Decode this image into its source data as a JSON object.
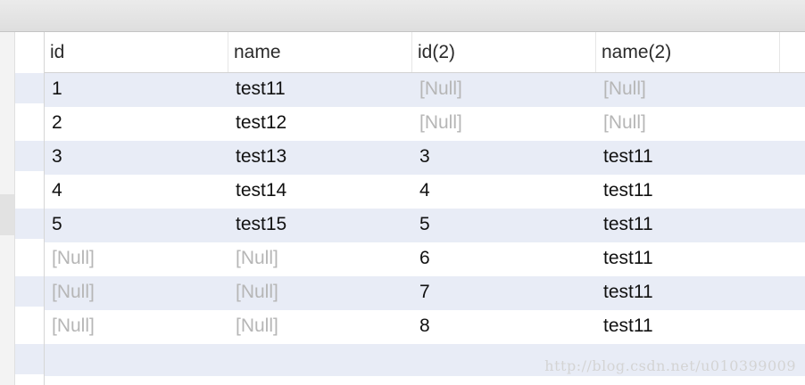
{
  "table": {
    "columns": [
      "id",
      "name",
      "id(2)",
      "name(2)"
    ],
    "rows": [
      [
        "1",
        "test11",
        "[Null]",
        "[Null]"
      ],
      [
        "2",
        "test12",
        "[Null]",
        "[Null]"
      ],
      [
        "3",
        "test13",
        "3",
        "test11"
      ],
      [
        "4",
        "test14",
        "4",
        "test11"
      ],
      [
        "5",
        "test15",
        "5",
        "test11"
      ],
      [
        "[Null]",
        "[Null]",
        "6",
        "test11"
      ],
      [
        "[Null]",
        "[Null]",
        "7",
        "test11"
      ],
      [
        "[Null]",
        "[Null]",
        "8",
        "test11"
      ]
    ],
    "null_text": "[Null]"
  },
  "colors": {
    "row_stripe": "#e8ecf6",
    "null_text": "#b6b6b6",
    "text": "#111111"
  },
  "watermark": "http://blog.csdn.net/u010399009"
}
